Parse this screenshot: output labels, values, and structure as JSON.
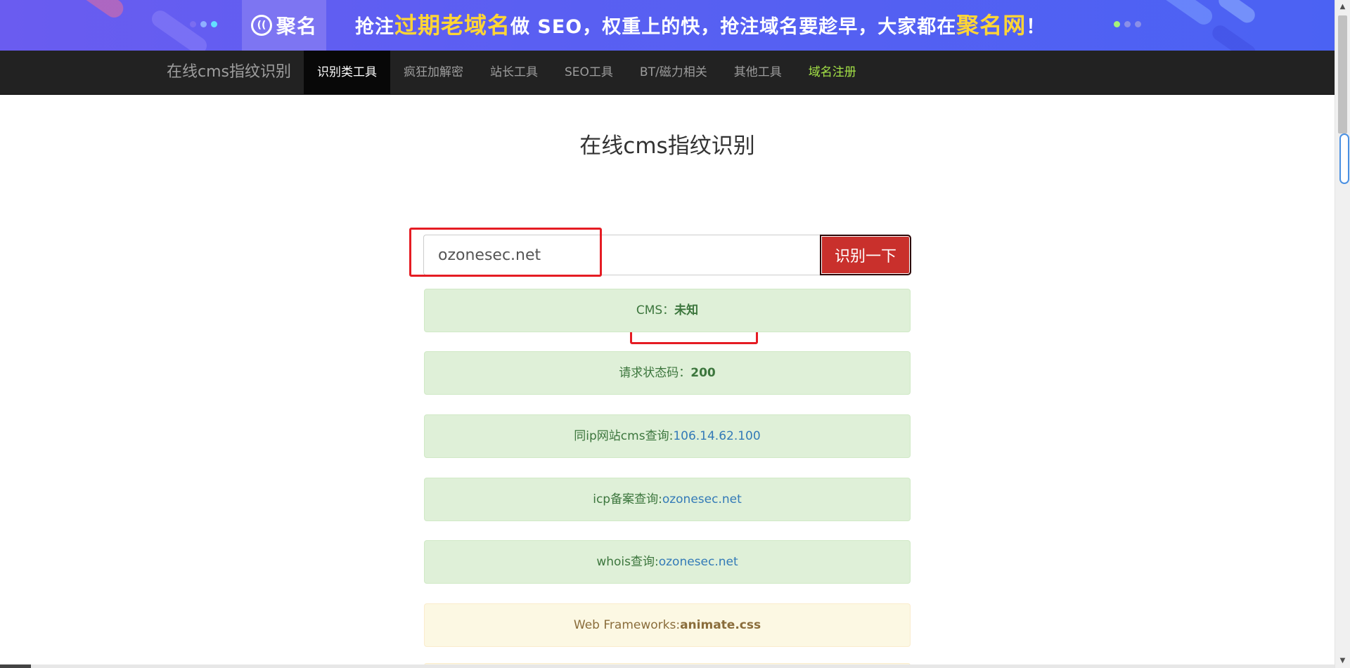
{
  "banner": {
    "brand_name": "聚名",
    "brand_logo_glyph": "((",
    "text_parts": [
      "抢注",
      "过期老域名",
      "做 SEO，权重上的快，抢注域名要趁早，大家都在",
      "聚名网",
      "！"
    ],
    "highlight_color": "#ffd535"
  },
  "navbar": {
    "brand": "在线cms指纹识别",
    "items": [
      {
        "label": "识别类工具",
        "state": "active"
      },
      {
        "label": "疯狂加解密",
        "state": "normal"
      },
      {
        "label": "站长工具",
        "state": "normal"
      },
      {
        "label": "SEO工具",
        "state": "normal"
      },
      {
        "label": "BT/磁力相关",
        "state": "normal"
      },
      {
        "label": "其他工具",
        "state": "normal"
      },
      {
        "label": "域名注册",
        "state": "highlight"
      }
    ]
  },
  "main": {
    "title": "在线cms指纹识别",
    "search": {
      "value": "ozonesec.net",
      "button_label": "识别一下"
    },
    "results": [
      {
        "label": "CMS：",
        "value": "未知",
        "style": "bold",
        "type": "success"
      },
      {
        "label": "请求状态码：",
        "value": "200",
        "style": "bold",
        "type": "success"
      },
      {
        "label": "同ip网站cms查询:",
        "value": "106.14.62.100",
        "style": "link",
        "type": "success"
      },
      {
        "label": "icp备案查询:",
        "value": "ozonesec.net",
        "style": "link",
        "type": "success"
      },
      {
        "label": "whois查询:",
        "value": "ozonesec.net",
        "style": "link",
        "type": "success"
      },
      {
        "label": "Web Frameworks:",
        "value": "animate.css",
        "style": "bold",
        "type": "warning"
      }
    ]
  },
  "colors": {
    "navbar_bg": "#222222",
    "active_nav_bg": "#080808",
    "button_red": "#c9302c",
    "annotation_red": "#e51c23",
    "success_bg": "#dff0d8",
    "warning_bg": "#fcf8e3",
    "link": "#337ab7"
  }
}
